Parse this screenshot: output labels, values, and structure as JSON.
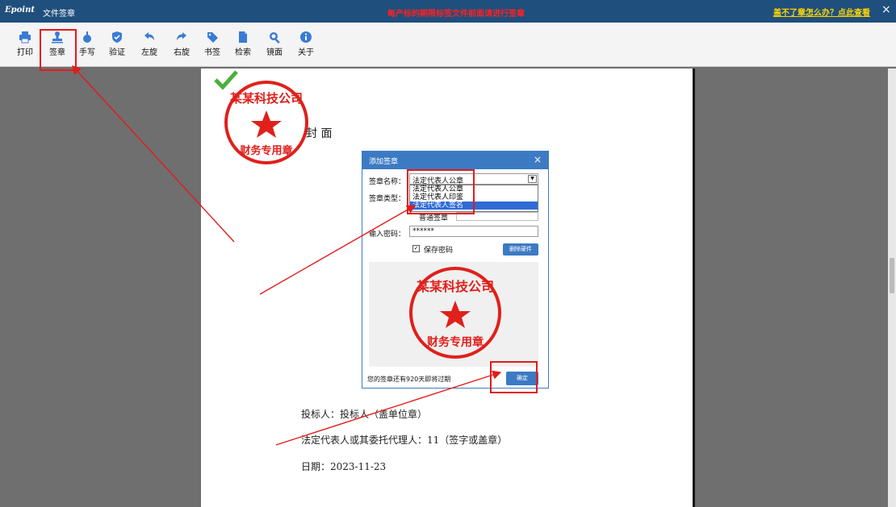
{
  "titlebar": {
    "logo": "Epoint",
    "title": "文件签章",
    "warning": "每产标的期限标签文件前面请进行签章",
    "help_link": "盖不了章怎么办？点此查看",
    "close": "×"
  },
  "toolbar": {
    "items": [
      {
        "label": "打印",
        "icon": "printer-icon"
      },
      {
        "label": "签章",
        "icon": "stamp-icon"
      },
      {
        "label": "手写",
        "icon": "handwrite-icon"
      },
      {
        "label": "验证",
        "icon": "shield-check-icon"
      },
      {
        "label": "左旋",
        "icon": "rotate-left-icon"
      },
      {
        "label": "右旋",
        "icon": "rotate-right-icon"
      },
      {
        "label": "书签",
        "icon": "bookmark-tag-icon"
      },
      {
        "label": "检索",
        "icon": "document-search-icon"
      },
      {
        "label": "镜面",
        "icon": "magnifier-icon"
      },
      {
        "label": "关于",
        "icon": "info-icon"
      }
    ],
    "highlight_color": "#e31b1b"
  },
  "document": {
    "cover_label": "封  面",
    "bidder": "投标人：投标人（盖单位章）",
    "legal_rep": "法定代表人或其委托代理人：11（签字或盖章）",
    "date": "日期：2023-11-23"
  },
  "stamp": {
    "company": "某某科技公司",
    "purpose": "财务专用章",
    "color": "#e0201b"
  },
  "dialog": {
    "title": "添加签章",
    "close": "×",
    "name_label": "签章名称：",
    "name_value": "法定代表人公章",
    "name_options": [
      "法定代表人公章",
      "法定代表人印鉴",
      "法定代表人签名"
    ],
    "selected_index": 2,
    "type_label": "签章类型：",
    "type_option": "普通签章",
    "password_label": "输入密码：",
    "password_value": "******",
    "save_password_label": "保存密码",
    "remove_cert_label": "删除硬件",
    "expiry_notice": "您的签章还有920天即将过期",
    "confirm_label": "确定"
  }
}
